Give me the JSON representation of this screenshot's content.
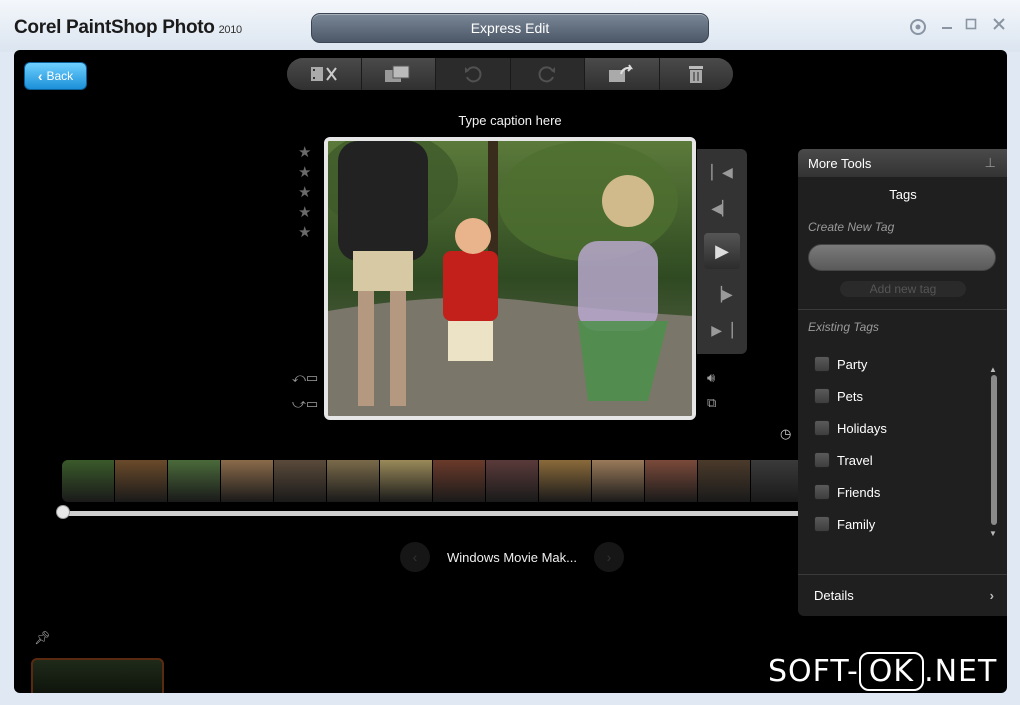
{
  "window": {
    "app_name": "Corel PaintShop Photo",
    "app_version": "2010",
    "mode": "Express Edit",
    "controls": [
      "settings-icon",
      "minimize-icon",
      "maximize-icon",
      "close-icon"
    ]
  },
  "nav": {
    "back_label": "Back"
  },
  "toolbar": {
    "buttons": [
      "video-trim-icon",
      "capture-frame-icon",
      "rotate-left-icon",
      "rotate-right-icon",
      "share-icon",
      "trash-icon"
    ]
  },
  "viewer": {
    "caption": "Type caption here",
    "rating": 0,
    "rating_max": 5,
    "timecode_icon": "clock-icon"
  },
  "player": {
    "file_name": "Windows Movie Mak..."
  },
  "side_panel": {
    "header": "More Tools",
    "section_title": "Tags",
    "create_label": "Create New Tag",
    "add_button": "Add new tag",
    "existing_label": "Existing Tags",
    "tags": [
      "Party",
      "Pets",
      "Holidays",
      "Travel",
      "Friends",
      "Family"
    ],
    "details_label": "Details"
  },
  "watermark": {
    "part1": "SOFT-",
    "part2": "OK",
    "part3": ".NET"
  }
}
